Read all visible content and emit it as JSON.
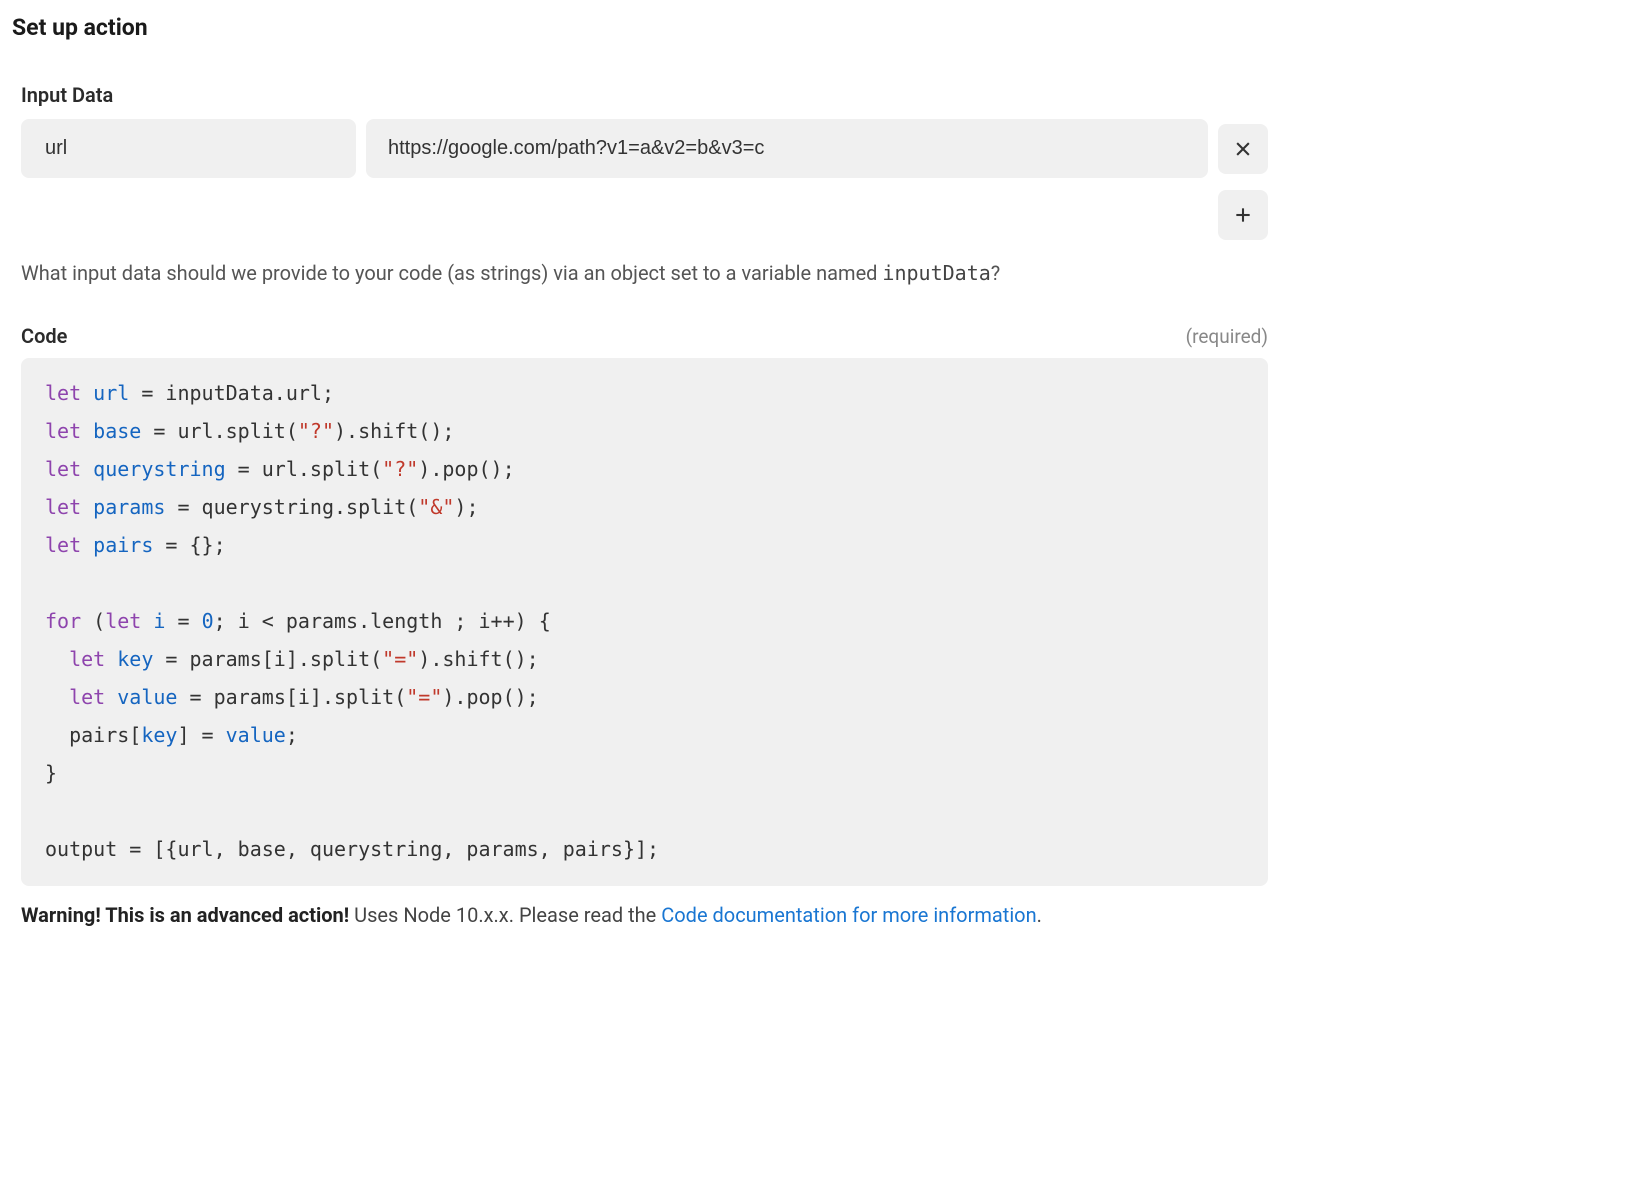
{
  "page_title": "Set up action",
  "input_data": {
    "label": "Input Data",
    "rows": [
      {
        "key": "url",
        "value": "https://google.com/path?v1=a&v2=b&v3=c"
      }
    ]
  },
  "help_text": {
    "prefix": "What input data should we provide to your code (as strings) via an object set to a variable named ",
    "code": "inputData",
    "suffix": "?"
  },
  "code_section": {
    "label": "Code",
    "required_label": "(required)",
    "lines": [
      [
        {
          "t": "kw",
          "v": "let"
        },
        {
          "t": "txt",
          "v": " "
        },
        {
          "t": "var",
          "v": "url"
        },
        {
          "t": "txt",
          "v": " = inputData.url;"
        }
      ],
      [
        {
          "t": "kw",
          "v": "let"
        },
        {
          "t": "txt",
          "v": " "
        },
        {
          "t": "var",
          "v": "base"
        },
        {
          "t": "txt",
          "v": " = url.split("
        },
        {
          "t": "str",
          "v": "\"?\""
        },
        {
          "t": "txt",
          "v": ").shift();"
        }
      ],
      [
        {
          "t": "kw",
          "v": "let"
        },
        {
          "t": "txt",
          "v": " "
        },
        {
          "t": "var",
          "v": "querystring"
        },
        {
          "t": "txt",
          "v": " = url.split("
        },
        {
          "t": "str",
          "v": "\"?\""
        },
        {
          "t": "txt",
          "v": ").pop();"
        }
      ],
      [
        {
          "t": "kw",
          "v": "let"
        },
        {
          "t": "txt",
          "v": " "
        },
        {
          "t": "var",
          "v": "params"
        },
        {
          "t": "txt",
          "v": " = querystring.split("
        },
        {
          "t": "str",
          "v": "\"&\""
        },
        {
          "t": "txt",
          "v": ");"
        }
      ],
      [
        {
          "t": "kw",
          "v": "let"
        },
        {
          "t": "txt",
          "v": " "
        },
        {
          "t": "var",
          "v": "pairs"
        },
        {
          "t": "txt",
          "v": " = {};"
        }
      ],
      [
        {
          "t": "txt",
          "v": ""
        }
      ],
      [
        {
          "t": "kw",
          "v": "for"
        },
        {
          "t": "txt",
          "v": " ("
        },
        {
          "t": "kw",
          "v": "let"
        },
        {
          "t": "txt",
          "v": " "
        },
        {
          "t": "var",
          "v": "i"
        },
        {
          "t": "txt",
          "v": " = "
        },
        {
          "t": "num",
          "v": "0"
        },
        {
          "t": "txt",
          "v": "; i < params.length ; i++) {"
        }
      ],
      [
        {
          "t": "txt",
          "v": "  "
        },
        {
          "t": "kw",
          "v": "let"
        },
        {
          "t": "txt",
          "v": " "
        },
        {
          "t": "var",
          "v": "key"
        },
        {
          "t": "txt",
          "v": " = params[i].split("
        },
        {
          "t": "str",
          "v": "\"=\""
        },
        {
          "t": "txt",
          "v": ").shift();"
        }
      ],
      [
        {
          "t": "txt",
          "v": "  "
        },
        {
          "t": "kw",
          "v": "let"
        },
        {
          "t": "txt",
          "v": " "
        },
        {
          "t": "var",
          "v": "value"
        },
        {
          "t": "txt",
          "v": " = params[i].split("
        },
        {
          "t": "str",
          "v": "\"=\""
        },
        {
          "t": "txt",
          "v": ").pop();"
        }
      ],
      [
        {
          "t": "txt",
          "v": "  pairs["
        },
        {
          "t": "var",
          "v": "key"
        },
        {
          "t": "txt",
          "v": "] = "
        },
        {
          "t": "var",
          "v": "value"
        },
        {
          "t": "txt",
          "v": ";"
        }
      ],
      [
        {
          "t": "txt",
          "v": "}"
        }
      ],
      [
        {
          "t": "txt",
          "v": ""
        }
      ],
      [
        {
          "t": "txt",
          "v": "output = [{url, base, querystring, params, pairs}];"
        }
      ]
    ]
  },
  "warning": {
    "strong": "Warning! This is an advanced action!",
    "middle": " Uses Node 10.x.x. Please read the ",
    "link": "Code documentation for more information",
    "end": "."
  }
}
